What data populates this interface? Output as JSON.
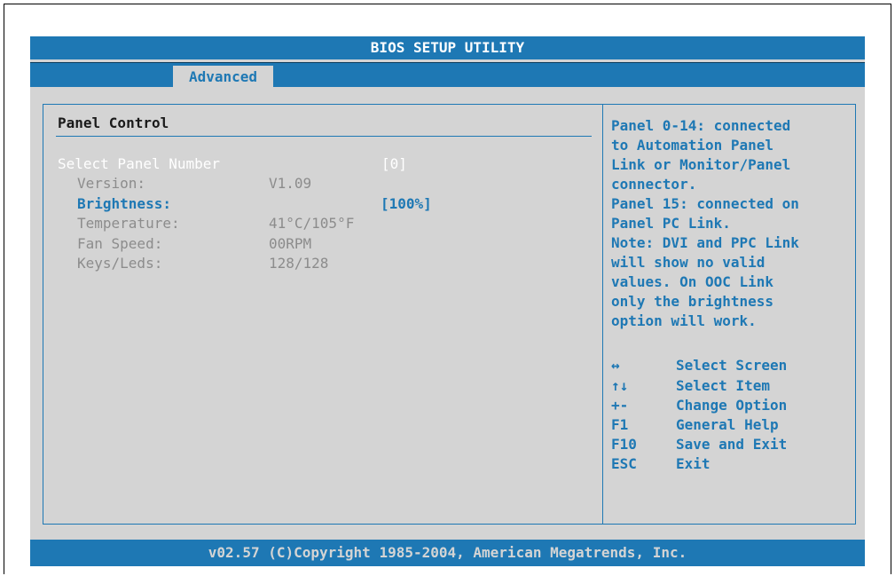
{
  "window": {
    "title": "BIOS SETUP UTILITY"
  },
  "tabs": [
    {
      "label": "Advanced",
      "active": true
    }
  ],
  "main": {
    "title": "Panel Control",
    "settings": [
      {
        "label": "Select Panel Number",
        "value": "[0]",
        "selectable": true,
        "selected": true
      },
      {
        "label": "Version:",
        "value": "V1.09",
        "selectable": false
      },
      {
        "label": "Brightness:",
        "value": "[100%]",
        "selectable": true,
        "selected": false
      },
      {
        "label": "Temperature:",
        "value": "41°C/105°F",
        "selectable": false
      },
      {
        "label": "Fan Speed:",
        "value": "00RPM",
        "selectable": false
      },
      {
        "label": "Keys/Leds:",
        "value": "128/128",
        "selectable": false
      }
    ]
  },
  "help": {
    "lines": [
      "Panel 0-14: connected",
      "to Automation Panel",
      "Link or Monitor/Panel",
      "connector.",
      "Panel 15: connected on",
      "Panel PC Link.",
      "Note: DVI and PPC Link",
      "will show no valid",
      "values. On OOC Link",
      "only the brightness",
      "option will work."
    ],
    "keys": [
      {
        "key": "↔",
        "icon": "left-right-arrow-icon",
        "desc": "Select Screen"
      },
      {
        "key": "↑↓",
        "icon": "up-down-arrow-icon",
        "desc": "Select Item"
      },
      {
        "key": "+-",
        "desc": "Change Option"
      },
      {
        "key": "F1",
        "desc": "General Help"
      },
      {
        "key": "F10",
        "desc": "Save and Exit"
      },
      {
        "key": "ESC",
        "desc": "Exit"
      }
    ]
  },
  "footer": {
    "text": "v02.57 (C)Copyright 1985-2004, American Megatrends, Inc."
  },
  "colors": {
    "accent": "#1e78b4",
    "background": "#d4d4d4",
    "highlight": "#ffffff",
    "disabled": "#8c8c8c"
  }
}
